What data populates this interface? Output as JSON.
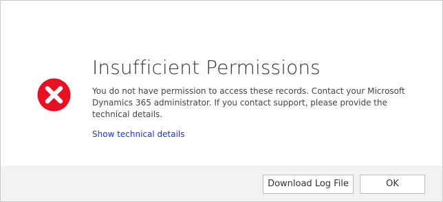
{
  "dialog": {
    "title": "Insufficient Permissions",
    "message": "You do not have permission to access these records. Contact your Microsoft Dynamics 365 administrator. If you contact support, please provide the technical details.",
    "link_label": "Show technical details",
    "icon": "error-x-icon",
    "icon_color": "#e81123"
  },
  "footer": {
    "download_label": "Download Log File",
    "ok_label": "OK"
  },
  "colors": {
    "link": "#1a3acd",
    "footer_bg": "#f2f2f2",
    "title_text": "#333333"
  }
}
